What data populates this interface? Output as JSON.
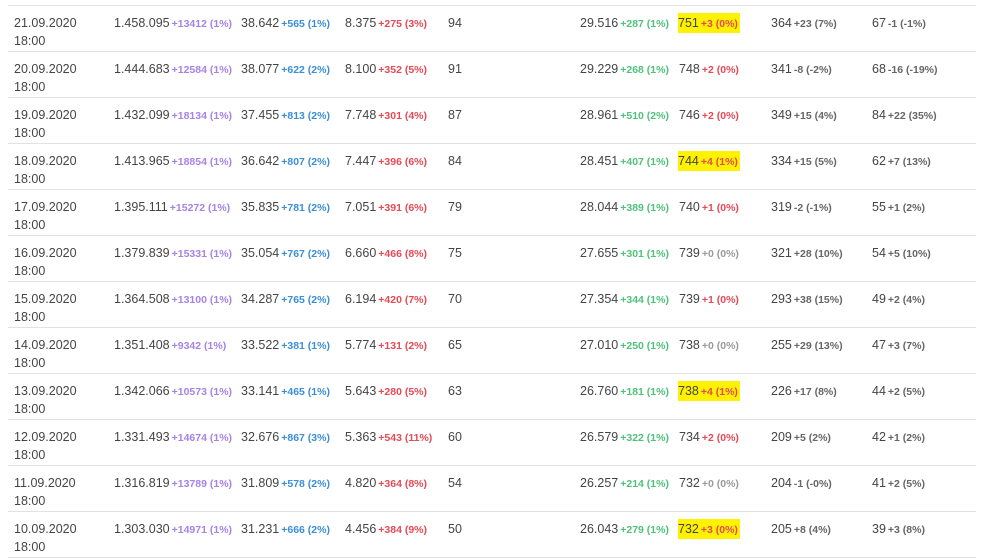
{
  "rows": [
    {
      "date": "21.09.2020",
      "time": "18:00",
      "c1": "1.458.095",
      "c1d": "+13412 (1%)",
      "c2": "38.642",
      "c2d": "+565 (1%)",
      "c3": "8.375",
      "c3d": "+275 (3%)",
      "c4": "94",
      "c5": "29.516",
      "c5d": "+287 (1%)",
      "c6": "751",
      "c6d": "+3 (0%)",
      "c6hl": true,
      "c6neutral": false,
      "c7": "364",
      "c7d": "+23 (7%)",
      "c8": "67",
      "c8d": "-1 (-1%)"
    },
    {
      "date": "20.09.2020",
      "time": "18:00",
      "c1": "1.444.683",
      "c1d": "+12584 (1%)",
      "c2": "38.077",
      "c2d": "+622 (2%)",
      "c3": "8.100",
      "c3d": "+352 (5%)",
      "c4": "91",
      "c5": "29.229",
      "c5d": "+268 (1%)",
      "c6": "748",
      "c6d": "+2 (0%)",
      "c6hl": false,
      "c6neutral": false,
      "c7": "341",
      "c7d": "-8 (-2%)",
      "c8": "68",
      "c8d": "-16 (-19%)"
    },
    {
      "date": "19.09.2020",
      "time": "18:00",
      "c1": "1.432.099",
      "c1d": "+18134 (1%)",
      "c2": "37.455",
      "c2d": "+813 (2%)",
      "c3": "7.748",
      "c3d": "+301 (4%)",
      "c4": "87",
      "c5": "28.961",
      "c5d": "+510 (2%)",
      "c6": "746",
      "c6d": "+2 (0%)",
      "c6hl": false,
      "c6neutral": false,
      "c7": "349",
      "c7d": "+15 (4%)",
      "c8": "84",
      "c8d": "+22 (35%)"
    },
    {
      "date": "18.09.2020",
      "time": "18:00",
      "c1": "1.413.965",
      "c1d": "+18854 (1%)",
      "c2": "36.642",
      "c2d": "+807 (2%)",
      "c3": "7.447",
      "c3d": "+396 (6%)",
      "c4": "84",
      "c5": "28.451",
      "c5d": "+407 (1%)",
      "c6": "744",
      "c6d": "+4 (1%)",
      "c6hl": true,
      "c6neutral": false,
      "c7": "334",
      "c7d": "+15 (5%)",
      "c8": "62",
      "c8d": "+7 (13%)"
    },
    {
      "date": "17.09.2020",
      "time": "18:00",
      "c1": "1.395.111",
      "c1d": "+15272 (1%)",
      "c2": "35.835",
      "c2d": "+781 (2%)",
      "c3": "7.051",
      "c3d": "+391 (6%)",
      "c4": "79",
      "c5": "28.044",
      "c5d": "+389 (1%)",
      "c6": "740",
      "c6d": "+1 (0%)",
      "c6hl": false,
      "c6neutral": false,
      "c7": "319",
      "c7d": "-2 (-1%)",
      "c8": "55",
      "c8d": "+1 (2%)"
    },
    {
      "date": "16.09.2020",
      "time": "18:00",
      "c1": "1.379.839",
      "c1d": "+15331 (1%)",
      "c2": "35.054",
      "c2d": "+767 (2%)",
      "c3": "6.660",
      "c3d": "+466 (8%)",
      "c4": "75",
      "c5": "27.655",
      "c5d": "+301 (1%)",
      "c6": "739",
      "c6d": "+0 (0%)",
      "c6hl": false,
      "c6neutral": true,
      "c7": "321",
      "c7d": "+28 (10%)",
      "c8": "54",
      "c8d": "+5 (10%)"
    },
    {
      "date": "15.09.2020",
      "time": "18:00",
      "c1": "1.364.508",
      "c1d": "+13100 (1%)",
      "c2": "34.287",
      "c2d": "+765 (2%)",
      "c3": "6.194",
      "c3d": "+420 (7%)",
      "c4": "70",
      "c5": "27.354",
      "c5d": "+344 (1%)",
      "c6": "739",
      "c6d": "+1 (0%)",
      "c6hl": false,
      "c6neutral": false,
      "c7": "293",
      "c7d": "+38 (15%)",
      "c8": "49",
      "c8d": "+2 (4%)"
    },
    {
      "date": "14.09.2020",
      "time": "18:00",
      "c1": "1.351.408",
      "c1d": "+9342 (1%)",
      "c2": "33.522",
      "c2d": "+381 (1%)",
      "c3": "5.774",
      "c3d": "+131 (2%)",
      "c4": "65",
      "c5": "27.010",
      "c5d": "+250 (1%)",
      "c6": "738",
      "c6d": "+0 (0%)",
      "c6hl": false,
      "c6neutral": true,
      "c7": "255",
      "c7d": "+29 (13%)",
      "c8": "47",
      "c8d": "+3 (7%)"
    },
    {
      "date": "13.09.2020",
      "time": "18:00",
      "c1": "1.342.066",
      "c1d": "+10573 (1%)",
      "c2": "33.141",
      "c2d": "+465 (1%)",
      "c3": "5.643",
      "c3d": "+280 (5%)",
      "c4": "63",
      "c5": "26.760",
      "c5d": "+181 (1%)",
      "c6": "738",
      "c6d": "+4 (1%)",
      "c6hl": true,
      "c6neutral": false,
      "c7": "226",
      "c7d": "+17 (8%)",
      "c8": "44",
      "c8d": "+2 (5%)"
    },
    {
      "date": "12.09.2020",
      "time": "18:00",
      "c1": "1.331.493",
      "c1d": "+14674 (1%)",
      "c2": "32.676",
      "c2d": "+867 (3%)",
      "c3": "5.363",
      "c3d": "+543 (11%)",
      "c4": "60",
      "c5": "26.579",
      "c5d": "+322 (1%)",
      "c6": "734",
      "c6d": "+2 (0%)",
      "c6hl": false,
      "c6neutral": false,
      "c7": "209",
      "c7d": "+5 (2%)",
      "c8": "42",
      "c8d": "+1 (2%)"
    },
    {
      "date": "11.09.2020",
      "time": "18:00",
      "c1": "1.316.819",
      "c1d": "+13789 (1%)",
      "c2": "31.809",
      "c2d": "+578 (2%)",
      "c3": "4.820",
      "c3d": "+364 (8%)",
      "c4": "54",
      "c5": "26.257",
      "c5d": "+214 (1%)",
      "c6": "732",
      "c6d": "+0 (0%)",
      "c6hl": false,
      "c6neutral": true,
      "c7": "204",
      "c7d": "-1 (-0%)",
      "c8": "41",
      "c8d": "+2 (5%)"
    },
    {
      "date": "10.09.2020",
      "time": "18:00",
      "c1": "1.303.030",
      "c1d": "+14971 (1%)",
      "c2": "31.231",
      "c2d": "+666 (2%)",
      "c3": "4.456",
      "c3d": "+384 (9%)",
      "c4": "50",
      "c5": "26.043",
      "c5d": "+279 (1%)",
      "c6": "732",
      "c6d": "+3 (0%)",
      "c6hl": true,
      "c6neutral": false,
      "c7": "205",
      "c7d": "+8 (4%)",
      "c8": "39",
      "c8d": "+3 (8%)"
    }
  ]
}
